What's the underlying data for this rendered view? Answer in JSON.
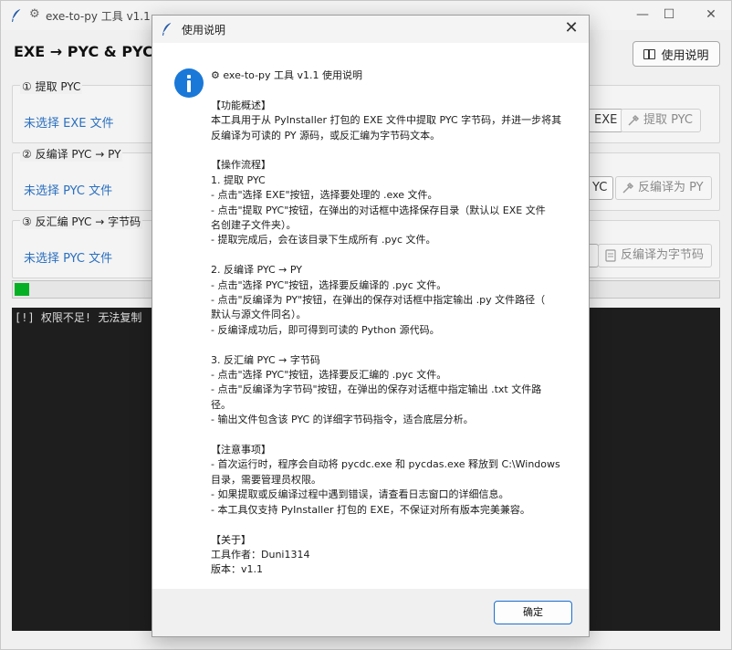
{
  "window": {
    "title": "exe-to-py 工具 v1.1",
    "minimize": "—",
    "maximize": "☐",
    "close": "✕"
  },
  "main": {
    "heading": "EXE → PYC  &  PYC",
    "help_button": "使用说明",
    "sections": [
      {
        "label": "① 提取 PYC",
        "file_status": "未选择 EXE 文件",
        "select_button": "EXE",
        "action_button": "提取 PYC"
      },
      {
        "label": "② 反编译 PYC → PY",
        "file_status": "未选择 PYC 文件",
        "select_button": "YC",
        "action_button": "反编译为 PY"
      },
      {
        "label": "③ 反汇编 PYC → 字节码",
        "file_status": "未选择 PYC 文件",
        "select_button": "",
        "action_button": "反编译为字节码"
      }
    ],
    "progress_fraction": 0.02,
    "log_line": "[!] 权限不足! 无法复制",
    "colors": {
      "link": "#2a6fbf",
      "progress": "#06b025",
      "console_bg": "#1e1e1e",
      "info_icon": "#1a78d8",
      "ok_border": "#1a6fd0"
    }
  },
  "dialog": {
    "title": "使用说明",
    "close": "✕",
    "icon": "info-icon",
    "lines": [
      "⚙ exe-to-py 工具 v1.1 使用说明",
      "",
      "【功能概述】",
      "本工具用于从 PyInstaller 打包的 EXE 文件中提取 PYC 字节码，并进一步将其",
      "反编译为可读的 PY 源码，或反汇编为字节码文本。",
      "",
      "【操作流程】",
      "1. 提取 PYC",
      "   - 点击\"选择 EXE\"按钮，选择要处理的 .exe 文件。",
      "   - 点击\"提取 PYC\"按钮，在弹出的对话框中选择保存目录（默认以 EXE 文件",
      "名创建子文件夹）。",
      "   - 提取完成后，会在该目录下生成所有 .pyc 文件。",
      "",
      "2. 反编译 PYC → PY",
      "   - 点击\"选择 PYC\"按钮，选择要反编译的 .pyc 文件。",
      "   - 点击\"反编译为 PY\"按钮，在弹出的保存对话框中指定输出 .py 文件路径（",
      "默认与源文件同名）。",
      "   - 反编译成功后，即可得到可读的 Python 源代码。",
      "",
      "3. 反汇编 PYC → 字节码",
      "   - 点击\"选择 PYC\"按钮，选择要反汇编的 .pyc 文件。",
      "   - 点击\"反编译为字节码\"按钮，在弹出的保存对话框中指定输出 .txt 文件路",
      "径。",
      "   - 输出文件包含该 PYC 的详细字节码指令，适合底层分析。",
      "",
      "【注意事项】",
      "- 首次运行时，程序会自动将 pycdc.exe 和 pycdas.exe 释放到 C:\\Windows",
      "目录，需要管理员权限。",
      "- 如果提取或反编译过程中遇到错误，请查看日志窗口的详细信息。",
      "- 本工具仅支持 PyInstaller 打包的 EXE，不保证对所有版本完美兼容。",
      "",
      "【关于】",
      "工具作者：Duni1314",
      "版本：v1.1"
    ],
    "ok_button": "确定"
  }
}
